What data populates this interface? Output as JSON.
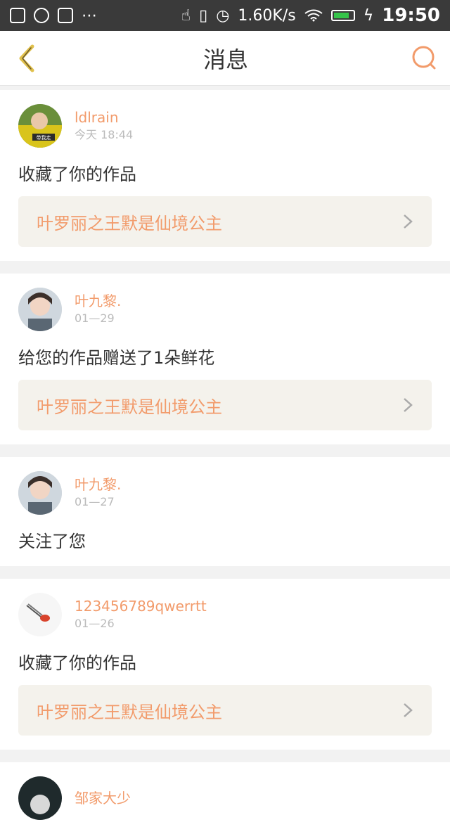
{
  "status": {
    "left_icons": [
      "image-icon",
      "chat-bubble-icon",
      "grid-apps-icon",
      "more-dots-icon"
    ],
    "speed": "1.60K/s",
    "time": "19:50"
  },
  "header": {
    "title": "消息"
  },
  "messages": [
    {
      "username": "ldlrain",
      "date": "今天 18:44",
      "action": "收藏了你的作品",
      "work": "叶罗丽之王默是仙境公主"
    },
    {
      "username": "叶九黎.",
      "date": "01—29",
      "action": "给您的作品赠送了1朵鲜花",
      "work": "叶罗丽之王默是仙境公主"
    },
    {
      "username": "叶九黎.",
      "date": "01—27",
      "action": "关注了您"
    },
    {
      "username": "123456789qwerrtt",
      "date": "01—26",
      "action": "收藏了你的作品",
      "work": "叶罗丽之王默是仙境公主"
    },
    {
      "username": "邹家大少"
    }
  ],
  "colors": {
    "accent": "#f29b6b",
    "back_icon": "#e0c04b",
    "status_bar": "#3a3a3a"
  },
  "avatar_1_text": "带我走"
}
